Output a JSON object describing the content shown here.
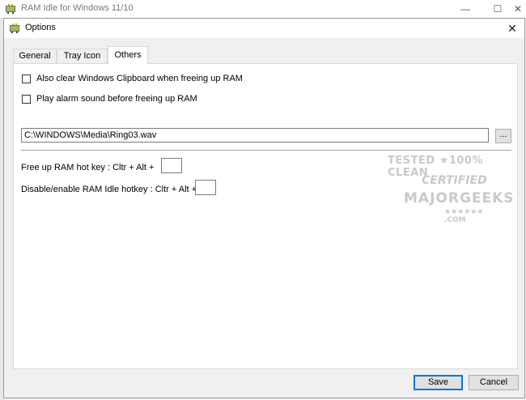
{
  "parent_window": {
    "title": "RAM Idle for Windows 11/10",
    "minimize": "—",
    "maximize": "☐",
    "close": "✕"
  },
  "dialog": {
    "title": "Options",
    "close": "✕"
  },
  "tabs": [
    {
      "label": "General",
      "active": false
    },
    {
      "label": "Tray Icon",
      "active": false
    },
    {
      "label": "Others",
      "active": true
    }
  ],
  "others": {
    "clear_clipboard": {
      "label": "Also clear Windows Clipboard when freeing up RAM",
      "checked": false
    },
    "play_alarm": {
      "label": "Play alarm sound before freeing up RAM",
      "checked": false
    },
    "sound_path": "C:\\WINDOWS\\Media\\Ring03.wav",
    "browse_label": "...",
    "free_hotkey_label": "Free up RAM hot key : Cltr + Alt +",
    "free_hotkey_value": "",
    "toggle_hotkey_label": "Disable/enable RAM Idle hotkey : Cltr + Alt +",
    "toggle_hotkey_value": ""
  },
  "buttons": {
    "save": "Save",
    "cancel": "Cancel"
  },
  "watermark": {
    "line1": "TESTED ★100% CLEAN",
    "line2": "CERTIFIED",
    "line3": "MAJORGEEKS",
    "line4": "★★★★★★ .COM"
  }
}
